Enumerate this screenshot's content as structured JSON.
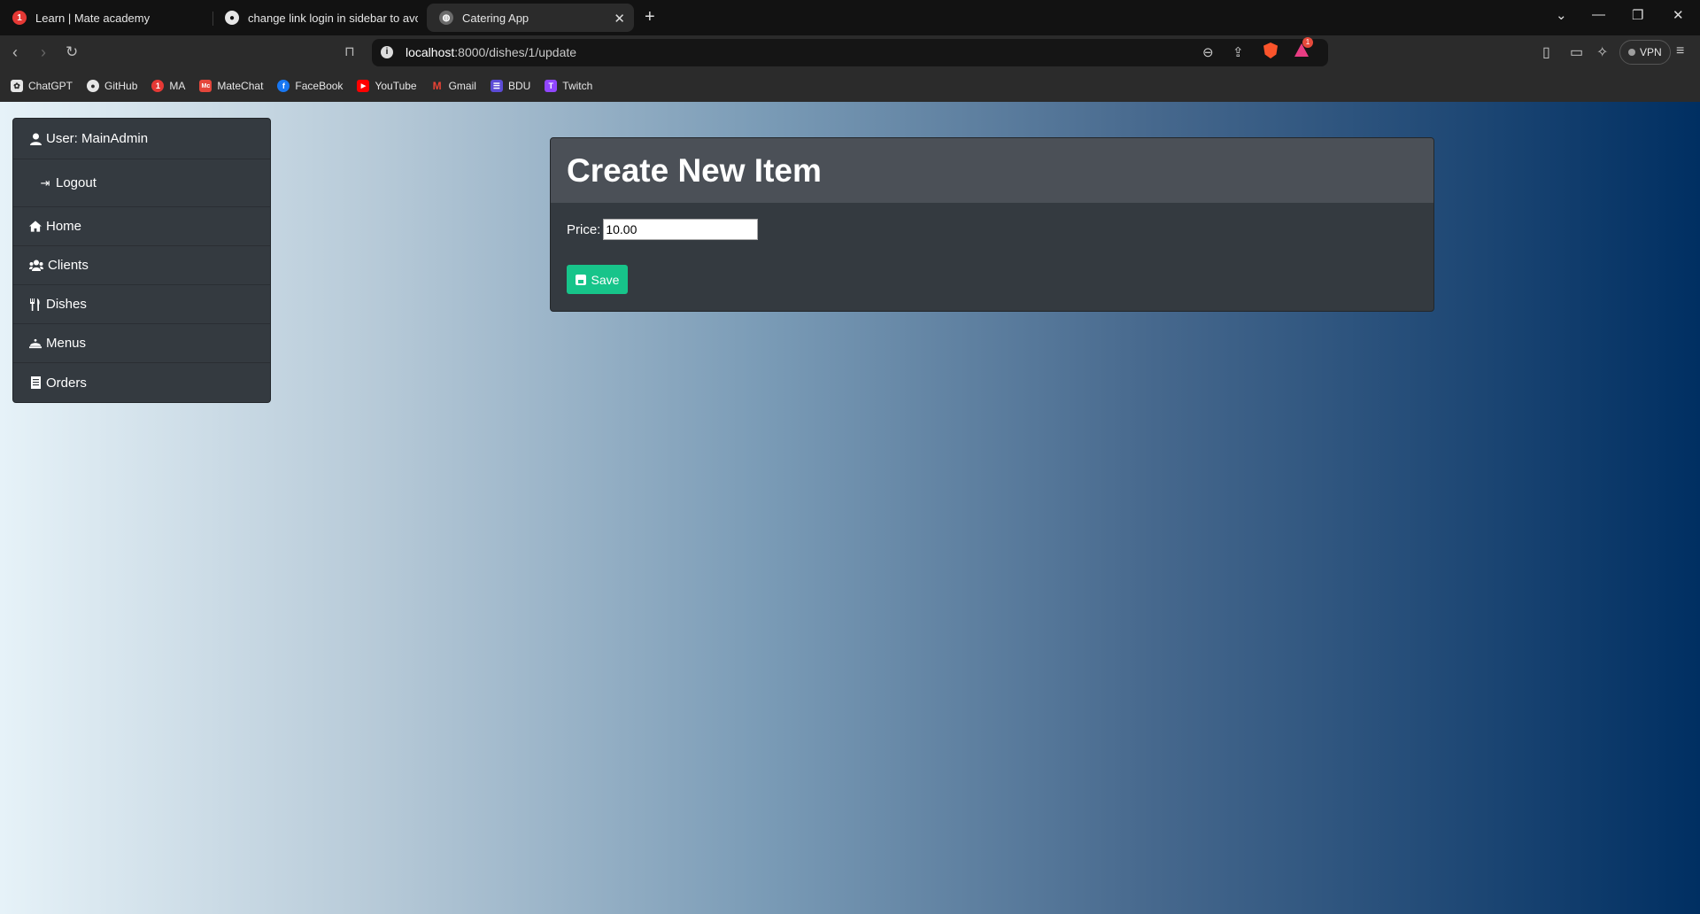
{
  "browser": {
    "tabs": [
      {
        "title": "Learn | Mate academy",
        "badge": "1"
      },
      {
        "title": "change link login in sidebar to avoid"
      },
      {
        "title": "Catering App",
        "active": true
      }
    ],
    "address": {
      "host": "localhost",
      "path": ":8000/dishes/1/update"
    },
    "rewards_badge": "1",
    "vpn_label": "VPN",
    "bookmarks": [
      {
        "label": "ChatGPT",
        "icon": "chatgpt-icon"
      },
      {
        "label": "GitHub",
        "icon": "github-icon"
      },
      {
        "label": "MA",
        "icon": "mate-academy-icon",
        "badge": "1"
      },
      {
        "label": "MateChat",
        "icon": "matechat-icon",
        "badge": "Mc"
      },
      {
        "label": "FaceBook",
        "icon": "facebook-icon",
        "badge": "f"
      },
      {
        "label": "YouTube",
        "icon": "youtube-icon",
        "badge": "▶"
      },
      {
        "label": "Gmail",
        "icon": "gmail-icon",
        "badge": "M"
      },
      {
        "label": "BDU",
        "icon": "bdu-icon",
        "badge": "☰"
      },
      {
        "label": "Twitch",
        "icon": "twitch-icon",
        "badge": "T"
      }
    ]
  },
  "sidebar": {
    "user_label": "User: MainAdmin",
    "logout_label": "Logout",
    "items": [
      {
        "label": "Home",
        "icon": "home-icon"
      },
      {
        "label": "Clients",
        "icon": "users-icon"
      },
      {
        "label": "Dishes",
        "icon": "utensils-icon"
      },
      {
        "label": "Menus",
        "icon": "cloche-icon"
      },
      {
        "label": "Orders",
        "icon": "receipt-icon"
      }
    ]
  },
  "form": {
    "title": "Create New Item",
    "price_label": "Price:",
    "price_value": "10.00",
    "save_label": "Save"
  },
  "colors": {
    "save_button": "#17c48a",
    "card_bg": "#343a40",
    "card_header_bg": "#4b5057",
    "gradient_start": "#e6f2f8",
    "gradient_end": "#002f62"
  }
}
